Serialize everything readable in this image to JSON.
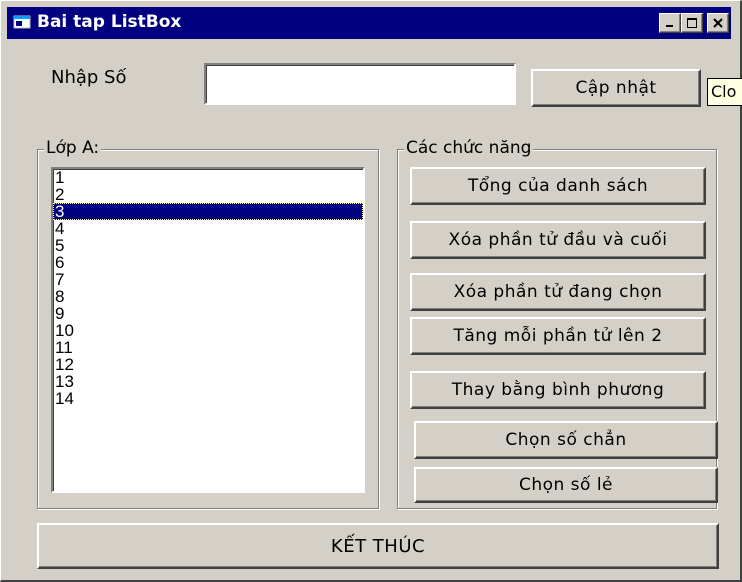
{
  "window": {
    "title": "Bai tap ListBox",
    "controls": {
      "minimize": "_",
      "maximize": "□",
      "close": "×"
    }
  },
  "input_row": {
    "label": "Nhập Số",
    "value": "",
    "update_button": "Cập nhật",
    "tooltip": "Clo"
  },
  "list_group": {
    "title": "Lớp A:",
    "items": [
      "1",
      "2",
      "3",
      "4",
      "5",
      "6",
      "7",
      "8",
      "9",
      "10",
      "11",
      "12",
      "13",
      "14"
    ],
    "selected_index": 2
  },
  "functions_group": {
    "title": "Các chức năng",
    "buttons": [
      "Tổng của danh sách",
      "Xóa phần tử đầu và cuối",
      "Xóa phần tử đang chọn",
      "Tăng mỗi phần tử lên 2",
      "Thay bằng bình phương",
      "Chọn số chẳn",
      "Chọn số lẻ"
    ]
  },
  "exit_button": "KẾT THÚC",
  "colors": {
    "title_bar": "#000080",
    "face": "#d4d0c8",
    "selection": "#000080",
    "tooltip_bg": "#ffffe1"
  },
  "icons": {
    "title": "app-window-icon"
  }
}
